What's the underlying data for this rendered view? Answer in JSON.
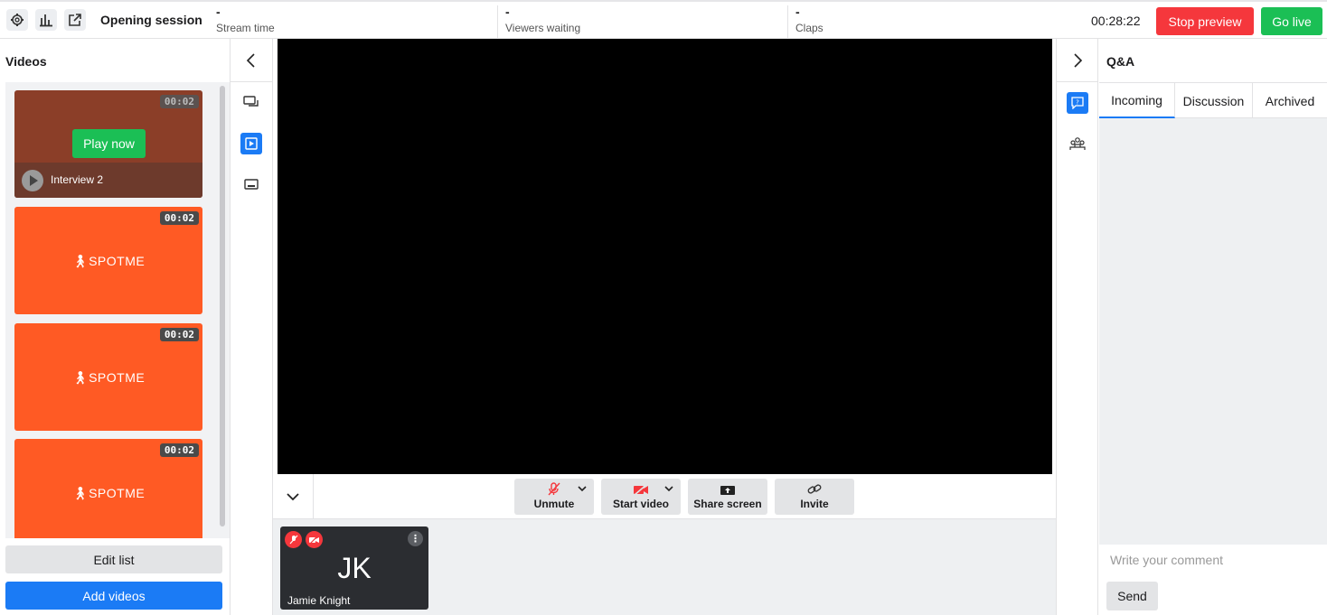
{
  "topbar": {
    "session_title": "Opening session",
    "stats": [
      {
        "value": "-",
        "label": "Stream time"
      },
      {
        "value": "-",
        "label": "Viewers waiting"
      },
      {
        "value": "-",
        "label": "Claps"
      }
    ],
    "timer": "00:28:22",
    "stop_preview_label": "Stop preview",
    "go_live_label": "Go live"
  },
  "videos": {
    "title": "Videos",
    "items": [
      {
        "duration": "00:02",
        "name": "Interview 2",
        "play_label": "Play now"
      },
      {
        "duration": "00:02",
        "logo": "SPOTME"
      },
      {
        "duration": "00:02",
        "logo": "SPOTME"
      },
      {
        "duration": "00:02",
        "logo": "SPOTME"
      }
    ],
    "edit_list_label": "Edit list",
    "add_videos_label": "Add videos"
  },
  "controls": {
    "unmute_label": "Unmute",
    "start_video_label": "Start video",
    "share_screen_label": "Share screen",
    "invite_label": "Invite"
  },
  "participant": {
    "initials": "JK",
    "name": "Jamie Knight"
  },
  "qa": {
    "title": "Q&A",
    "tabs": [
      "Incoming",
      "Discussion",
      "Archived"
    ],
    "comment_placeholder": "Write your comment",
    "send_label": "Send"
  },
  "colors": {
    "accent": "#1b7bf5",
    "danger": "#f5373c",
    "success": "#1bbf55",
    "brand_orange": "#ff5a24"
  }
}
